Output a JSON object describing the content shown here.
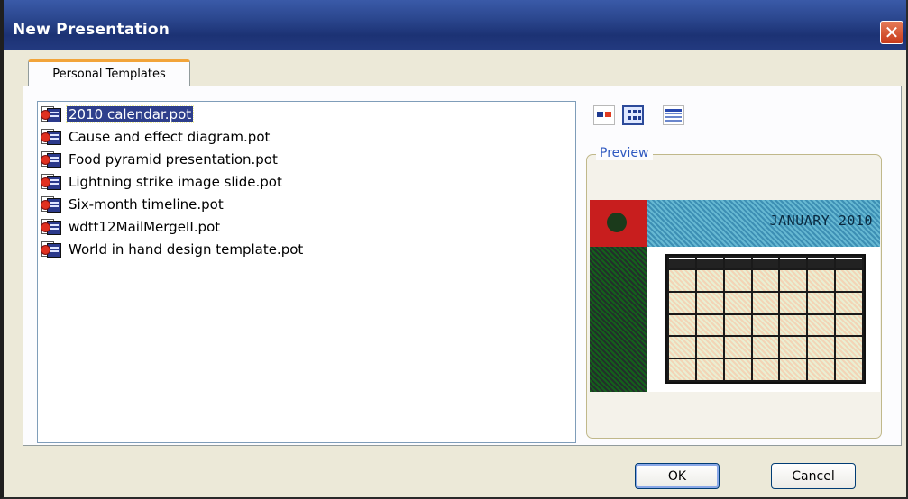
{
  "window": {
    "title": "New Presentation"
  },
  "tabs": [
    {
      "label": "Personal Templates",
      "active": true
    }
  ],
  "templates": [
    {
      "name": "2010 calendar.pot",
      "selected": true
    },
    {
      "name": "Cause and effect diagram.pot",
      "selected": false
    },
    {
      "name": "Food pyramid presentation.pot",
      "selected": false
    },
    {
      "name": "Lightning strike image slide.pot",
      "selected": false
    },
    {
      "name": "Six-month timeline.pot",
      "selected": false
    },
    {
      "name": "wdtt12MailMergeII.pot",
      "selected": false
    },
    {
      "name": "World in hand design template.pot",
      "selected": false
    }
  ],
  "view_buttons": [
    {
      "icon": "large-icons-view-icon",
      "active": false
    },
    {
      "icon": "list-view-icon",
      "active": true
    },
    {
      "icon": "details-view-icon",
      "active": false
    }
  ],
  "preview": {
    "legend": "Preview",
    "slide_title": "JANUARY 2010"
  },
  "buttons": {
    "ok": "OK",
    "cancel": "Cancel"
  },
  "colors": {
    "titlebar": "#2c4890",
    "selection": "#2e3f8c",
    "tab_accent": "#f2a43a",
    "preview_label": "#2e58c0"
  }
}
